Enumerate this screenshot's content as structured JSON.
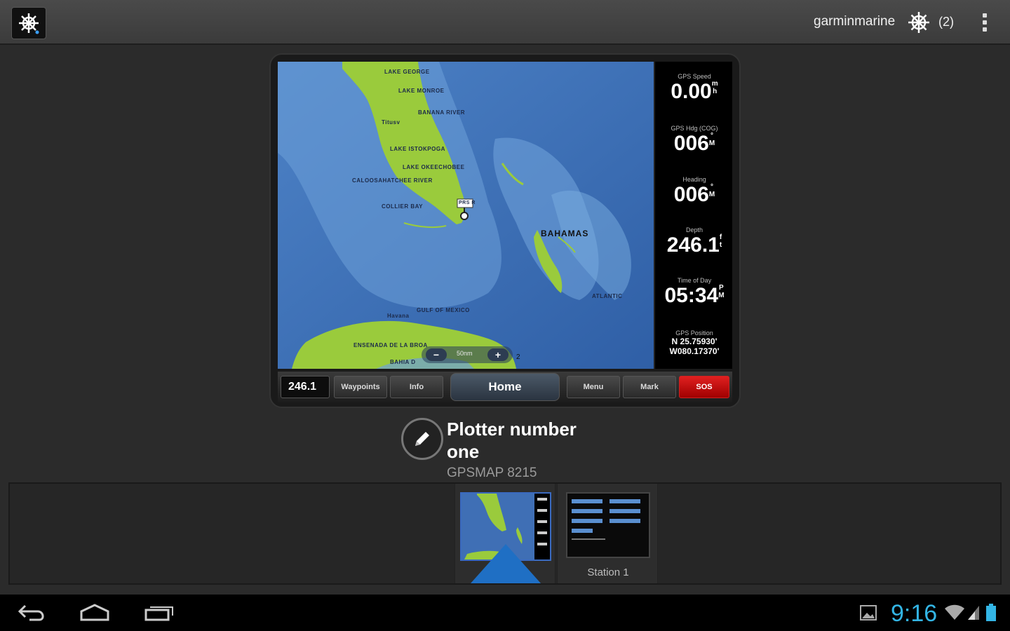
{
  "topbar": {
    "app_icon": "ship-wheel-icon",
    "user": "garminmarine",
    "notifications_icon": "ship-wheel-icon",
    "count": "(2)",
    "overflow_icon": "overflow-menu-icon"
  },
  "map": {
    "labels": [
      "LAKE GEORGE",
      "LAKE MONROE",
      "BANANA RIVER",
      "Titusv",
      "LAKE ISTOKPOGA",
      "LAKE OKEECHOBEE",
      "CALOOSAHATCHEE RIVER",
      "COLLIER BAY",
      "BAHAMAS",
      "ATLANTIC",
      "GULF OF MEXICO",
      "Havana",
      "ENSENADA DE LA BROA",
      "BAHIA D"
    ],
    "boat_label": "PRS R",
    "scale": "50nm",
    "scale_small": "2"
  },
  "gauges": {
    "speed": {
      "label": "GPS Speed",
      "value": "0.00",
      "unit_top": "m",
      "unit_bottom": "h"
    },
    "cog": {
      "label": "GPS Hdg (COG)",
      "value": "006",
      "unit_top": "°",
      "unit_bottom": "M"
    },
    "heading": {
      "label": "Heading",
      "value": "006",
      "unit_top": "°",
      "unit_bottom": "M"
    },
    "depth": {
      "label": "Depth",
      "value": "246.1",
      "unit_top": "f",
      "unit_bottom": "t"
    },
    "time": {
      "label": "Time of Day",
      "value": "05:34",
      "unit_top": "P",
      "unit_bottom": "M"
    },
    "position": {
      "label": "GPS Position",
      "lat": "N  25.75930'",
      "lon": "W080.17370'"
    }
  },
  "softkeys": {
    "depth": "246.1",
    "waypoints": "Waypoints",
    "info": "Info",
    "home": "Home",
    "menu": "Menu",
    "mark": "Mark",
    "sos": "SOS"
  },
  "device": {
    "edit_icon": "pencil-icon",
    "title": "Plotter number one",
    "model": "GPSMAP 8215"
  },
  "filmstrip": {
    "items": [
      {
        "caption": "",
        "selected": true
      },
      {
        "caption": "Station 1",
        "selected": false
      }
    ]
  },
  "systembar": {
    "back_icon": "back-icon",
    "home_icon": "home-icon",
    "recents_icon": "recent-apps-icon",
    "gallery_icon": "picture-icon",
    "clock": "9:16",
    "wifi_icon": "wifi-icon",
    "signal_icon": "signal-icon",
    "battery_icon": "battery-icon"
  },
  "colors": {
    "accent_blue": "#33b5e5",
    "selection_blue": "#1f6fc4",
    "sos_red": "#d01818",
    "land_green": "#9acb3c",
    "water_blue": "#3f6fb5"
  }
}
